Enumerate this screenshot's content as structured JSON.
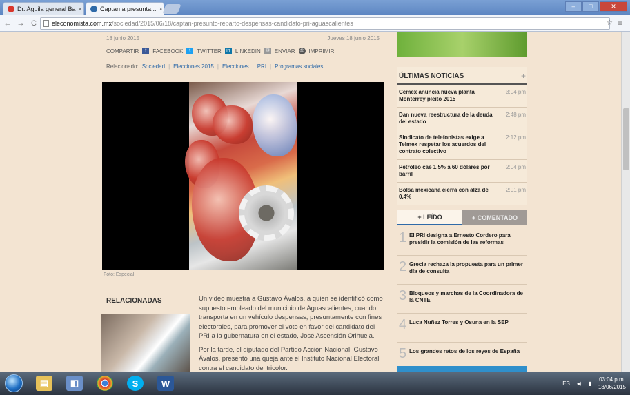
{
  "browser": {
    "tabs": [
      {
        "title": "Dr. Aguila general Ba",
        "fav_color": "#d9362b"
      },
      {
        "title": "Captan a presunta...",
        "fav_color": "#2f6aa8"
      }
    ],
    "close_glyph": "×",
    "url_host": "eleconomista.com.mx",
    "url_path": "/sociedad/2015/06/18/captan-presunto-reparto-despensas-candidato-pri-aguascalientes",
    "nav": {
      "back": "←",
      "forward": "→",
      "reload": "C"
    },
    "window": {
      "minimize": "–",
      "maximize": "□",
      "close": "✕"
    },
    "menu_glyph": "≡",
    "ext_glyph": "☆"
  },
  "article": {
    "date_left": "18 junio 2015",
    "date_right": "Jueves 18 junio 2015",
    "share_label": "COMPARTIR",
    "share": [
      {
        "name": "FACEBOOK",
        "glyph": "f",
        "color": "#3b5998"
      },
      {
        "name": "TWITTER",
        "glyph": "t",
        "color": "#1da1f2"
      },
      {
        "name": "LINKEDIN",
        "glyph": "in",
        "color": "#0e76a8"
      },
      {
        "name": "ENVIAR",
        "glyph": "✉",
        "color": "#999999"
      },
      {
        "name": "IMPRIMIR",
        "glyph": "⎙",
        "color": "#555555"
      }
    ],
    "tags_label": "Relacionado:",
    "tags": [
      "Sociedad",
      "Elecciones 2015",
      "Elecciones",
      "PRI",
      "Programas sociales"
    ],
    "photo_caption": "Foto: Especial",
    "related_title": "RELACIONADAS",
    "paragraphs": [
      "Un video muestra a Gustavo Ávalos, a quien se identificó como supuesto empleado del municipio de Aguascalientes, cuando transporta en un vehículo despensas, presuntamente con fines electorales, para promover el voto en favor del candidato del PRI a la gubernatura en el estado, José Ascensión Orihuela.",
      "Por la tarde, el diputado del Partido Acción Nacional, Gustavo Ávalos, presentó una queja ante el Instituto Nacional Electoral contra el candidato del tricolor."
    ]
  },
  "sidebar": {
    "news_title": "ÚLTIMAS NOTICIAS",
    "news_plus": "+",
    "news": [
      {
        "title": "Cemex anuncia nueva planta Monterrey pleito 2015",
        "time": "3:04 pm"
      },
      {
        "title": "Dan nueva reestructura de la deuda del estado",
        "time": "2:48 pm"
      },
      {
        "title": "Sindicato de telefonistas exige a Telmex respetar los acuerdos del contrato colectivo",
        "time": "2:12 pm"
      },
      {
        "title": "Petróleo cae 1.5% a 60 dólares por barril",
        "time": "2:04 pm"
      },
      {
        "title": "Bolsa mexicana cierra con alza de 0.4%",
        "time": "2:01 pm"
      }
    ],
    "tab_read": "+ LEÍDO",
    "tab_comment": "+ COMENTADO",
    "ranked": [
      {
        "n": "1",
        "title": "El PRI designa a Ernesto Cordero para presidir la comisión de las reformas"
      },
      {
        "n": "2",
        "title": "Grecia rechaza la propuesta para un primer día de consulta"
      },
      {
        "n": "3",
        "title": "Bloqueos y marchas de la Coordinadora de la CNTE"
      },
      {
        "n": "4",
        "title": "Luca Nuñez Torres y Osuna en la SEP"
      },
      {
        "n": "5",
        "title": "Los grandes retos de los reyes de España"
      }
    ]
  },
  "taskbar": {
    "apps": [
      {
        "name": "explorer",
        "glyph": "▤",
        "color": "#e7c25a"
      },
      {
        "name": "control-panel",
        "glyph": "◧",
        "color": "#6a8fc8"
      },
      {
        "name": "chrome",
        "glyph": "◉",
        "color": "#d9362b"
      },
      {
        "name": "skype",
        "glyph": "S",
        "color": "#00aff0"
      },
      {
        "name": "word",
        "glyph": "W",
        "color": "#2b5797"
      }
    ],
    "tray_lang": "ES",
    "clock_time": "03:04 p.m.",
    "clock_date": "18/06/2015"
  },
  "colors": {
    "accent": "#2f6aa8",
    "page_bg": "#f3e4d2"
  }
}
